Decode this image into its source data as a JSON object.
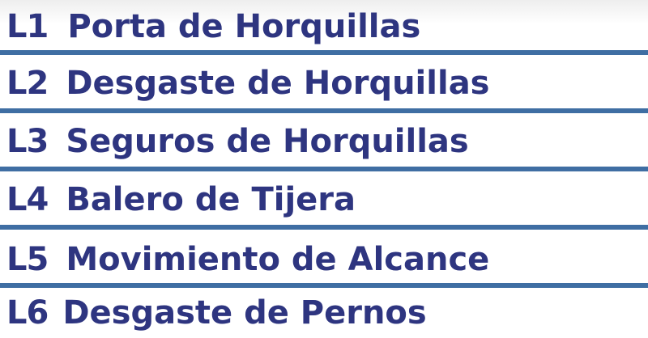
{
  "items": [
    {
      "code": "L1",
      "label": "Porta de Horquillas"
    },
    {
      "code": "L2",
      "label": "Desgaste de Horquillas"
    },
    {
      "code": "L3",
      "label": "Seguros de Horquillas"
    },
    {
      "code": "L4",
      "label": "Balero de Tijera"
    },
    {
      "code": "L5",
      "label": "Movimiento de Alcance"
    },
    {
      "code": "L6",
      "label": "Desgaste de Pernos"
    }
  ],
  "colors": {
    "text": "#2e3580",
    "divider": "#3f6ea3",
    "background": "#ffffff"
  }
}
